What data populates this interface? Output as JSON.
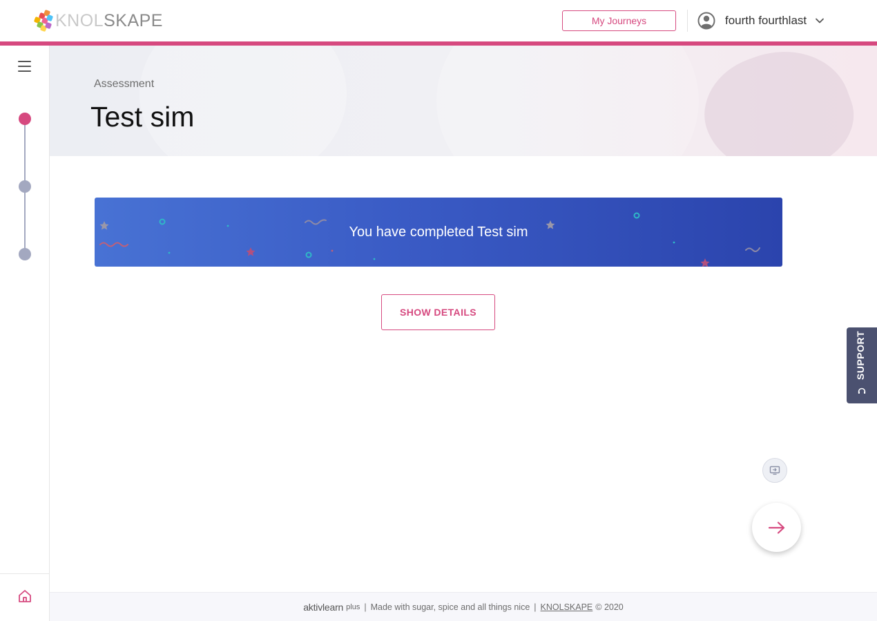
{
  "header": {
    "logo_text_light": "KNOL",
    "logo_text_dark": "SKAPE",
    "my_journeys_label": "My Journeys",
    "user_name": "fourth fourthlast"
  },
  "rail": {
    "steps": [
      "active",
      "inactive",
      "inactive"
    ]
  },
  "hero": {
    "subtitle": "Assessment",
    "title": "Test sim"
  },
  "banner": {
    "message": "You have completed Test sim"
  },
  "actions": {
    "show_details_label": "SHOW DETAILS"
  },
  "support": {
    "label": "SUPPORT"
  },
  "footer": {
    "brand": "aktivlearn",
    "brand_suffix": "plus",
    "tagline": "Made with sugar, spice and all things nice",
    "company_link": "KNOLSKAPE",
    "copyright": "© 2020"
  },
  "colors": {
    "accent": "#d6497f",
    "banner_start": "#4872d4",
    "banner_end": "#2b44ad",
    "step_inactive": "#a3a8c0",
    "support_bg": "#4b5170"
  },
  "icons": {
    "menu": "hamburger-icon",
    "user": "user-avatar-icon",
    "dropdown": "chevron-down-icon",
    "home": "home-icon",
    "support": "headset-icon",
    "mini": "present-icon",
    "next": "arrow-right-icon"
  }
}
